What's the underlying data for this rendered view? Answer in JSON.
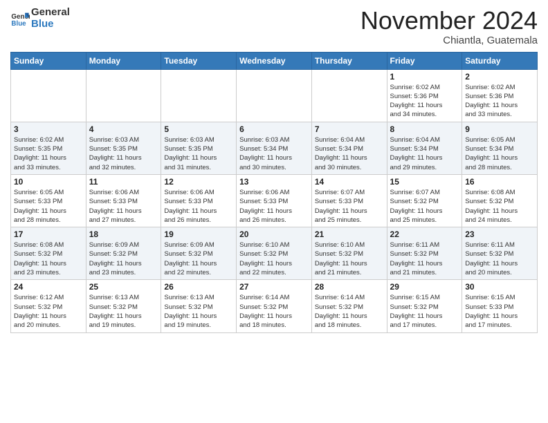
{
  "header": {
    "logo_general": "General",
    "logo_blue": "Blue",
    "month_title": "November 2024",
    "location": "Chiantla, Guatemala"
  },
  "weekdays": [
    "Sunday",
    "Monday",
    "Tuesday",
    "Wednesday",
    "Thursday",
    "Friday",
    "Saturday"
  ],
  "weeks": [
    [
      {
        "day": "",
        "info": ""
      },
      {
        "day": "",
        "info": ""
      },
      {
        "day": "",
        "info": ""
      },
      {
        "day": "",
        "info": ""
      },
      {
        "day": "",
        "info": ""
      },
      {
        "day": "1",
        "info": "Sunrise: 6:02 AM\nSunset: 5:36 PM\nDaylight: 11 hours\nand 34 minutes."
      },
      {
        "day": "2",
        "info": "Sunrise: 6:02 AM\nSunset: 5:36 PM\nDaylight: 11 hours\nand 33 minutes."
      }
    ],
    [
      {
        "day": "3",
        "info": "Sunrise: 6:02 AM\nSunset: 5:35 PM\nDaylight: 11 hours\nand 33 minutes."
      },
      {
        "day": "4",
        "info": "Sunrise: 6:03 AM\nSunset: 5:35 PM\nDaylight: 11 hours\nand 32 minutes."
      },
      {
        "day": "5",
        "info": "Sunrise: 6:03 AM\nSunset: 5:35 PM\nDaylight: 11 hours\nand 31 minutes."
      },
      {
        "day": "6",
        "info": "Sunrise: 6:03 AM\nSunset: 5:34 PM\nDaylight: 11 hours\nand 30 minutes."
      },
      {
        "day": "7",
        "info": "Sunrise: 6:04 AM\nSunset: 5:34 PM\nDaylight: 11 hours\nand 30 minutes."
      },
      {
        "day": "8",
        "info": "Sunrise: 6:04 AM\nSunset: 5:34 PM\nDaylight: 11 hours\nand 29 minutes."
      },
      {
        "day": "9",
        "info": "Sunrise: 6:05 AM\nSunset: 5:34 PM\nDaylight: 11 hours\nand 28 minutes."
      }
    ],
    [
      {
        "day": "10",
        "info": "Sunrise: 6:05 AM\nSunset: 5:33 PM\nDaylight: 11 hours\nand 28 minutes."
      },
      {
        "day": "11",
        "info": "Sunrise: 6:06 AM\nSunset: 5:33 PM\nDaylight: 11 hours\nand 27 minutes."
      },
      {
        "day": "12",
        "info": "Sunrise: 6:06 AM\nSunset: 5:33 PM\nDaylight: 11 hours\nand 26 minutes."
      },
      {
        "day": "13",
        "info": "Sunrise: 6:06 AM\nSunset: 5:33 PM\nDaylight: 11 hours\nand 26 minutes."
      },
      {
        "day": "14",
        "info": "Sunrise: 6:07 AM\nSunset: 5:33 PM\nDaylight: 11 hours\nand 25 minutes."
      },
      {
        "day": "15",
        "info": "Sunrise: 6:07 AM\nSunset: 5:32 PM\nDaylight: 11 hours\nand 25 minutes."
      },
      {
        "day": "16",
        "info": "Sunrise: 6:08 AM\nSunset: 5:32 PM\nDaylight: 11 hours\nand 24 minutes."
      }
    ],
    [
      {
        "day": "17",
        "info": "Sunrise: 6:08 AM\nSunset: 5:32 PM\nDaylight: 11 hours\nand 23 minutes."
      },
      {
        "day": "18",
        "info": "Sunrise: 6:09 AM\nSunset: 5:32 PM\nDaylight: 11 hours\nand 23 minutes."
      },
      {
        "day": "19",
        "info": "Sunrise: 6:09 AM\nSunset: 5:32 PM\nDaylight: 11 hours\nand 22 minutes."
      },
      {
        "day": "20",
        "info": "Sunrise: 6:10 AM\nSunset: 5:32 PM\nDaylight: 11 hours\nand 22 minutes."
      },
      {
        "day": "21",
        "info": "Sunrise: 6:10 AM\nSunset: 5:32 PM\nDaylight: 11 hours\nand 21 minutes."
      },
      {
        "day": "22",
        "info": "Sunrise: 6:11 AM\nSunset: 5:32 PM\nDaylight: 11 hours\nand 21 minutes."
      },
      {
        "day": "23",
        "info": "Sunrise: 6:11 AM\nSunset: 5:32 PM\nDaylight: 11 hours\nand 20 minutes."
      }
    ],
    [
      {
        "day": "24",
        "info": "Sunrise: 6:12 AM\nSunset: 5:32 PM\nDaylight: 11 hours\nand 20 minutes."
      },
      {
        "day": "25",
        "info": "Sunrise: 6:13 AM\nSunset: 5:32 PM\nDaylight: 11 hours\nand 19 minutes."
      },
      {
        "day": "26",
        "info": "Sunrise: 6:13 AM\nSunset: 5:32 PM\nDaylight: 11 hours\nand 19 minutes."
      },
      {
        "day": "27",
        "info": "Sunrise: 6:14 AM\nSunset: 5:32 PM\nDaylight: 11 hours\nand 18 minutes."
      },
      {
        "day": "28",
        "info": "Sunrise: 6:14 AM\nSunset: 5:32 PM\nDaylight: 11 hours\nand 18 minutes."
      },
      {
        "day": "29",
        "info": "Sunrise: 6:15 AM\nSunset: 5:32 PM\nDaylight: 11 hours\nand 17 minutes."
      },
      {
        "day": "30",
        "info": "Sunrise: 6:15 AM\nSunset: 5:33 PM\nDaylight: 11 hours\nand 17 minutes."
      }
    ]
  ]
}
